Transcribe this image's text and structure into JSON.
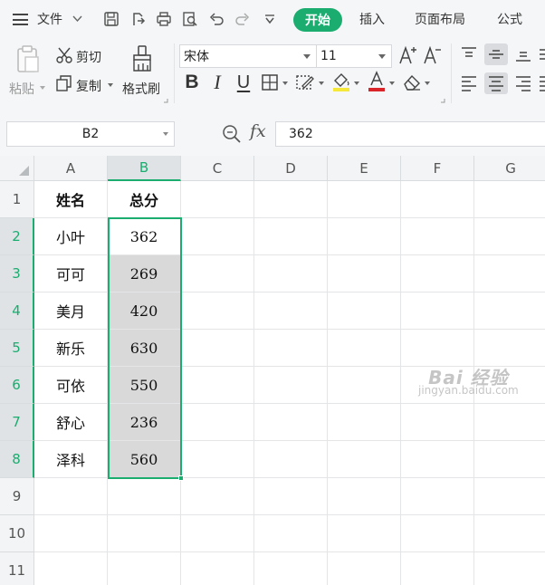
{
  "menubar": {
    "file_label": "文件",
    "tabs": [
      {
        "label": "开始",
        "active": true
      },
      {
        "label": "插入",
        "active": false
      },
      {
        "label": "页面布局",
        "active": false
      },
      {
        "label": "公式",
        "active": false
      }
    ]
  },
  "ribbon": {
    "paste_label": "粘贴",
    "cut_label": "剪切",
    "copy_label": "复制",
    "format_painter_label": "格式刷",
    "font_name": "宋体",
    "font_size": "11",
    "bold_label": "B",
    "italic_label": "I",
    "underline_label": "U",
    "font_color": "#d9242a",
    "fill_color": "#f6e83a",
    "accent_color": "#1aad6f"
  },
  "formula_bar": {
    "name_box": "B2",
    "fx_label": "fx",
    "value": "362"
  },
  "sheet": {
    "columns": [
      "A",
      "B",
      "C",
      "D",
      "E",
      "F",
      "G"
    ],
    "rows": [
      "1",
      "2",
      "3",
      "4",
      "5",
      "6",
      "7",
      "8",
      "9",
      "10",
      "11"
    ],
    "active_column": "B",
    "header_row": {
      "name": "姓名",
      "score": "总分"
    },
    "data": [
      {
        "name": "小叶",
        "score": "362"
      },
      {
        "name": "可可",
        "score": "269"
      },
      {
        "name": "美月",
        "score": "420"
      },
      {
        "name": "新乐",
        "score": "630"
      },
      {
        "name": "可依",
        "score": "550"
      },
      {
        "name": "舒心",
        "score": "236"
      },
      {
        "name": "泽科",
        "score": "560"
      }
    ]
  },
  "watermark": {
    "brand": "Bai 经验",
    "url": "jingyan.baidu.com"
  }
}
